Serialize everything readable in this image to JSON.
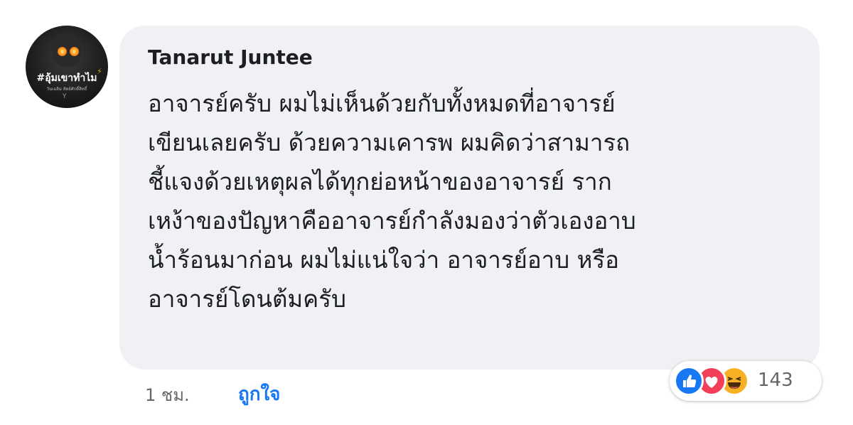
{
  "comment": {
    "author": "Tanarut Juntee",
    "text": "อาจารย์ครับ ผมไม่เห็นด้วยกับทั้งหมดที่อาจารย์\nเขียนเลยครับ ด้วยความเคารพ ผมคิดว่าสามารถ\nชี้แจงด้วยเหตุผลได้ทุกย่อหน้าของอาจารย์ ราก\nเหง้าของปัญหาคืออาจารย์กำลังมองว่าตัวเองอาบ\nน้ำร้อนมาก่อน ผมไม่แน่ใจว่า อาจารย์อาบ หรือ\nอาจารย์โดนต้มครับ",
    "timestamp": "1 ชม.",
    "like_label": "ถูกใจ",
    "reaction_count": "143",
    "reactions": [
      "like-icon",
      "love-icon",
      "haha-icon"
    ]
  },
  "avatar": {
    "caption": "#อุ้มเขาทำไม",
    "subcaption": "วันเฉลิม สัตย์ศักดิ์สิทธิ์",
    "mark": "Y"
  },
  "colors": {
    "bubble": "#eff1f4",
    "link": "#1877f2",
    "like": "#1877f2",
    "love": "#f33e58",
    "haha": "#f7b125"
  }
}
